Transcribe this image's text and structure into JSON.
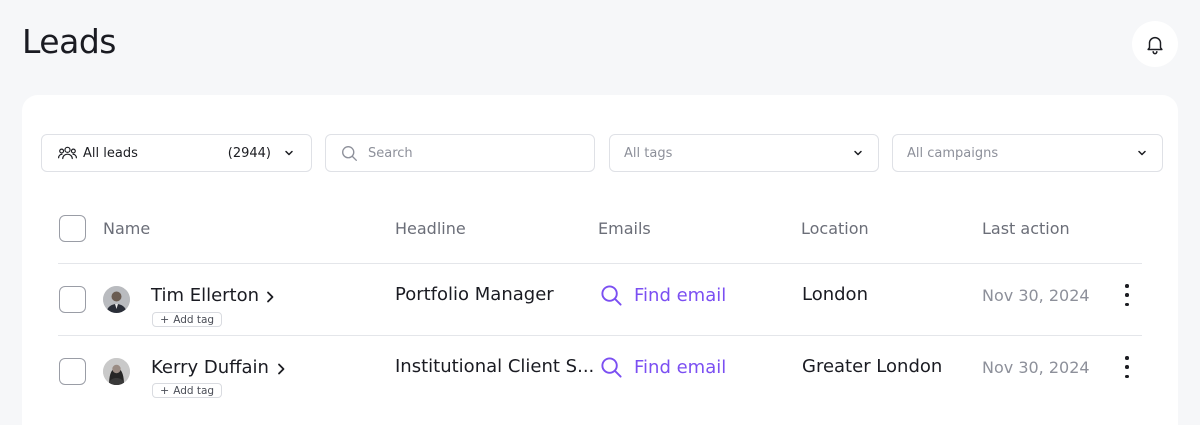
{
  "page": {
    "title": "Leads"
  },
  "filters": {
    "leads": {
      "label": "All leads",
      "count": "(2944)"
    },
    "search": {
      "placeholder": "Search"
    },
    "tags": {
      "placeholder": "All tags"
    },
    "campaigns": {
      "placeholder": "All campaigns"
    }
  },
  "table": {
    "columns": [
      "Name",
      "Headline",
      "Emails",
      "Location",
      "Last action"
    ],
    "rows": [
      {
        "name": "Tim Ellerton",
        "add_tag": "Add tag",
        "headline": "Portfolio Manager",
        "email_action": "Find email",
        "location": "London",
        "last_action": "Nov 30, 2024"
      },
      {
        "name": "Kerry Duffain",
        "add_tag": "Add tag",
        "headline": "Institutional Client S...",
        "email_action": "Find email",
        "location": "Greater London",
        "last_action": "Nov 30, 2024"
      }
    ]
  },
  "colors": {
    "accent": "#7b4ff2",
    "background": "#f6f7f9",
    "card": "#ffffff"
  },
  "icons": [
    "bell-icon",
    "users-icon",
    "chevron-down-icon",
    "search-icon",
    "chevron-right-icon",
    "kebab-menu-icon"
  ]
}
